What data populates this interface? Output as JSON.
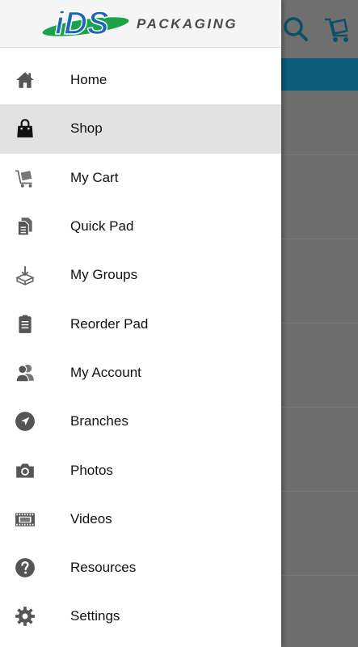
{
  "brand": {
    "logo_text": "iDS",
    "word": "PACKAGING",
    "colors": {
      "logo_blue": "#1c67b3",
      "logo_green": "#1aa34a",
      "word": "#4a4a4a"
    }
  },
  "background_app": {
    "icons": [
      "search-icon",
      "cart-icon"
    ],
    "tabbar_color": "#0c5b79"
  },
  "menu": {
    "active_index": 1,
    "items": [
      {
        "label": "Home",
        "icon": "home-icon"
      },
      {
        "label": "Shop",
        "icon": "shopping-bag-icon"
      },
      {
        "label": "My Cart",
        "icon": "cart-icon"
      },
      {
        "label": "Quick Pad",
        "icon": "documents-icon"
      },
      {
        "label": "My Groups",
        "icon": "box-download-icon"
      },
      {
        "label": "Reorder Pad",
        "icon": "clipboard-icon"
      },
      {
        "label": "My Account",
        "icon": "users-icon"
      },
      {
        "label": "Branches",
        "icon": "navigation-arrow-icon"
      },
      {
        "label": "Photos",
        "icon": "camera-icon"
      },
      {
        "label": "Videos",
        "icon": "film-icon"
      },
      {
        "label": "Resources",
        "icon": "help-icon"
      },
      {
        "label": "Settings",
        "icon": "gear-icon"
      }
    ]
  }
}
